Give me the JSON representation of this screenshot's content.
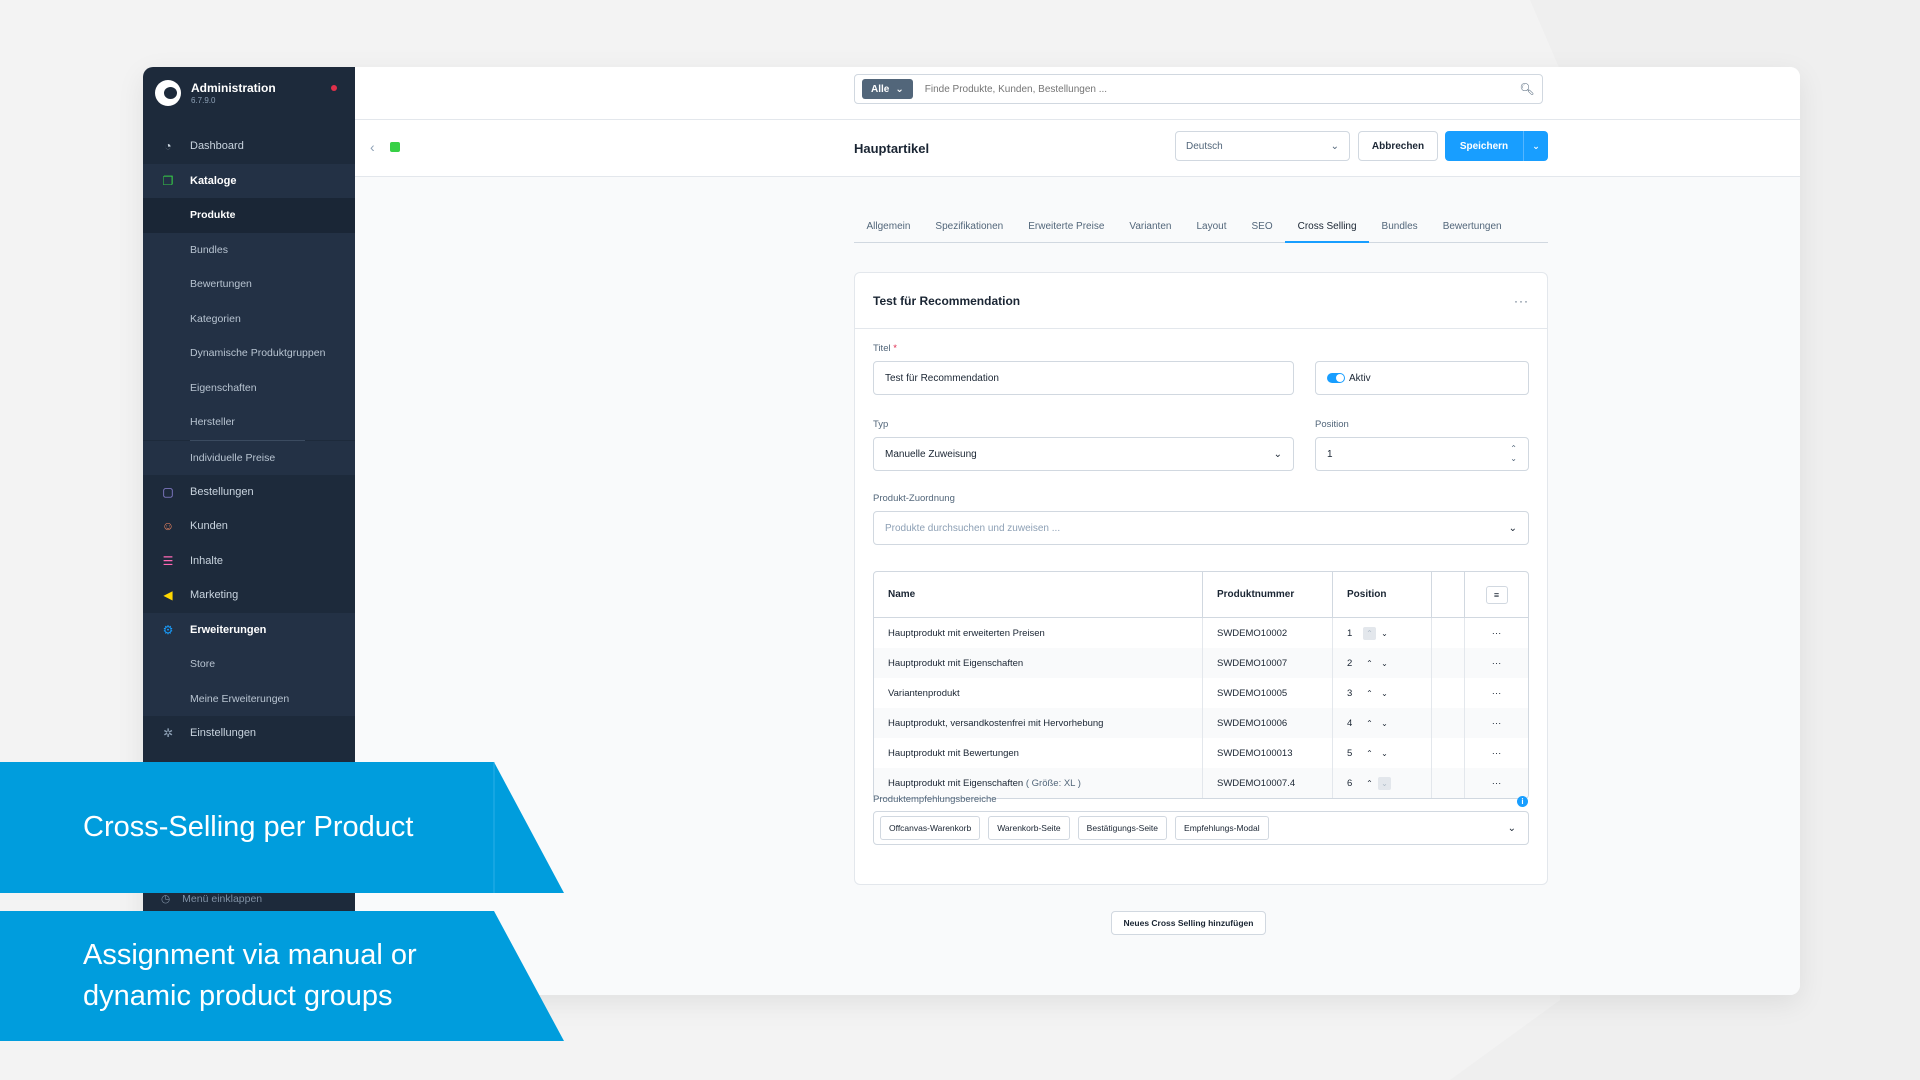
{
  "colors": {
    "accent": "#189eff",
    "sidebar": "#1d2a3b",
    "banner": "#009ddd",
    "required": "#de294c"
  },
  "sidebar": {
    "title": "Administration",
    "version": "6.7.9.0",
    "items": [
      {
        "label": "Dashboard",
        "icon": "dashboard-icon"
      },
      {
        "label": "Kataloge",
        "icon": "catalog-icon"
      },
      {
        "label": "Produkte"
      },
      {
        "label": "Bundles"
      },
      {
        "label": "Bewertungen"
      },
      {
        "label": "Kategorien"
      },
      {
        "label": "Dynamische Produktgruppen"
      },
      {
        "label": "Eigenschaften"
      },
      {
        "label": "Hersteller"
      },
      {
        "label": "Individuelle Preise"
      },
      {
        "label": "Bestellungen",
        "icon": "orders-icon"
      },
      {
        "label": "Kunden",
        "icon": "customers-icon"
      },
      {
        "label": "Inhalte",
        "icon": "content-icon"
      },
      {
        "label": "Marketing",
        "icon": "marketing-icon"
      },
      {
        "label": "Erweiterungen",
        "icon": "extensions-icon"
      },
      {
        "label": "Store"
      },
      {
        "label": "Meine Erweiterungen"
      },
      {
        "label": "Einstellungen",
        "icon": "settings-icon"
      }
    ],
    "collapse_label": "Menü einklappen"
  },
  "search": {
    "filter": "Alle",
    "placeholder": "Finde Produkte, Kunden, Bestellungen ..."
  },
  "smartbar": {
    "title": "Hauptartikel",
    "language": "Deutsch",
    "cancel": "Abbrechen",
    "save": "Speichern"
  },
  "tabs": [
    "Allgemein",
    "Spezifikationen",
    "Erweiterte Preise",
    "Varianten",
    "Layout",
    "SEO",
    "Cross Selling",
    "Bundles",
    "Bewertungen"
  ],
  "active_tab": "Cross Selling",
  "card": {
    "title": "Test für Recommendation",
    "title_label": "Titel",
    "title_required": "*",
    "title_value": "Test für Recommendation",
    "active_label": "Aktiv",
    "type_label": "Typ",
    "type_value": "Manuelle Zuweisung",
    "position_label": "Position",
    "position_value": "1",
    "assignment_label": "Produkt-Zuordnung",
    "assignment_placeholder": "Produkte durchsuchen und zuweisen ...",
    "grid": {
      "headers": {
        "name": "Name",
        "number": "Produktnummer",
        "position": "Position"
      },
      "rows": [
        {
          "name": "Hauptprodukt mit erweiterten Preisen",
          "variant": "",
          "number": "SWDEMO10002",
          "position": "1"
        },
        {
          "name": "Hauptprodukt mit Eigenschaften",
          "variant": "",
          "number": "SWDEMO10007",
          "position": "2"
        },
        {
          "name": "Variantenprodukt",
          "variant": "",
          "number": "SWDEMO10005",
          "position": "3"
        },
        {
          "name": "Hauptprodukt, versandkostenfrei mit Hervorhebung",
          "variant": "",
          "number": "SWDEMO10006",
          "position": "4"
        },
        {
          "name": "Hauptprodukt mit Bewertungen",
          "variant": "",
          "number": "SWDEMO100013",
          "position": "5"
        },
        {
          "name": "Hauptprodukt mit Eigenschaften",
          "variant": "( Größe: XL )",
          "number": "SWDEMO10007.4",
          "position": "6"
        }
      ]
    },
    "recommendation_label": "Produktempfehlungsbereiche",
    "recommendation_tags": [
      "Offcanvas-Warenkorb",
      "Warenkorb-Seite",
      "Bestätigungs-Seite",
      "Empfehlungs-Modal"
    ]
  },
  "new_cross_selling": "Neues Cross Selling hinzufügen",
  "banners": {
    "first": "Cross-Selling per Product",
    "second_line1": "Assignment via manual or",
    "second_line2": "dynamic product groups"
  }
}
